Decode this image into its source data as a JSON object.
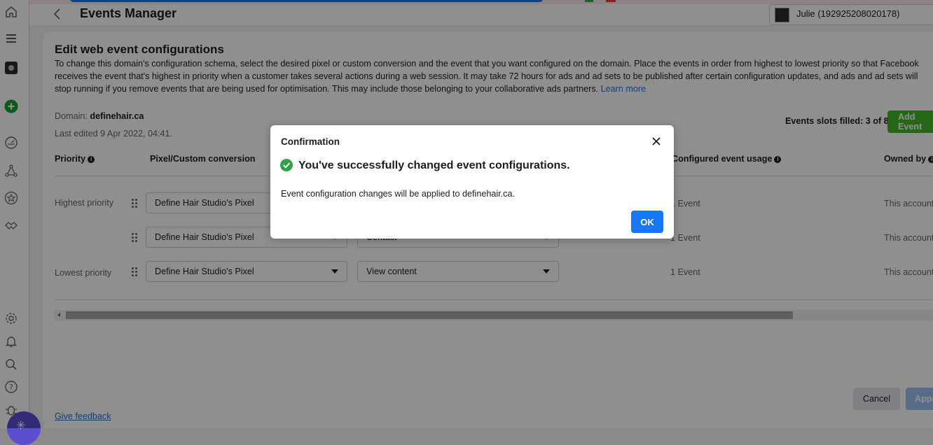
{
  "header": {
    "app_title": "Events Manager",
    "account_name": "Julie (192925208020178)"
  },
  "page": {
    "title": "Edit web event configurations",
    "description": "To change this domain's configuration schema, select the desired pixel or custom conversion and the event that you want configured on the domain. Place the events in order from highest to lowest priority so that Facebook receives the event that's highest in priority when a customer takes several actions during a web session. It may take 72 hours for ads and ad sets to be published after certain configuration updates, and ads and ad sets will stop running if you remove events that are being used for optimisation. This may include those belonging to your collaborative ads partners.",
    "learn_more": "Learn more",
    "domain_label": "Domain:",
    "domain_value": "definehair.ca",
    "last_edited": "Last edited 9 Apr 2022, 04:41.",
    "slots_filled": "Events slots filled: 3 of 8",
    "add_event": "Add Event"
  },
  "table": {
    "headers": {
      "priority": "Priority",
      "pixel": "Pixel/Custom conversion",
      "usage": "Configured event usage",
      "owned_by": "Owned by"
    },
    "rows": [
      {
        "priority_label": "Highest priority",
        "pixel": "Define Hair Studio's Pixel",
        "event": "",
        "usage": "1 Event",
        "owner": "This account"
      },
      {
        "priority_label": "",
        "pixel": "Define Hair Studio's Pixel",
        "event": "Contact",
        "usage": "1 Event",
        "owner": "This account"
      },
      {
        "priority_label": "Lowest priority",
        "pixel": "Define Hair Studio's Pixel",
        "event": "View content",
        "usage": "1 Event",
        "owner": "This account"
      }
    ]
  },
  "footer": {
    "cancel": "Cancel",
    "apply": "Apply",
    "feedback": "Give feedback"
  },
  "modal": {
    "title": "Confirmation",
    "heading": "You've successfully changed event configurations.",
    "body": "Event configuration changes will be applied to definehair.ca.",
    "ok": "OK"
  },
  "icons": {
    "rail": [
      "home-icon",
      "menu-icon",
      "account-avatar",
      "create-plus-icon",
      "dashboard-icon",
      "network-icon",
      "star-icon",
      "handshake-icon",
      "settings-icon",
      "notification-bell-icon",
      "search-icon",
      "help-icon",
      "bug-icon"
    ]
  },
  "colors": {
    "primary": "#1877f2",
    "success": "#42b72a",
    "link": "#216fdb",
    "check": "#31a24c"
  }
}
